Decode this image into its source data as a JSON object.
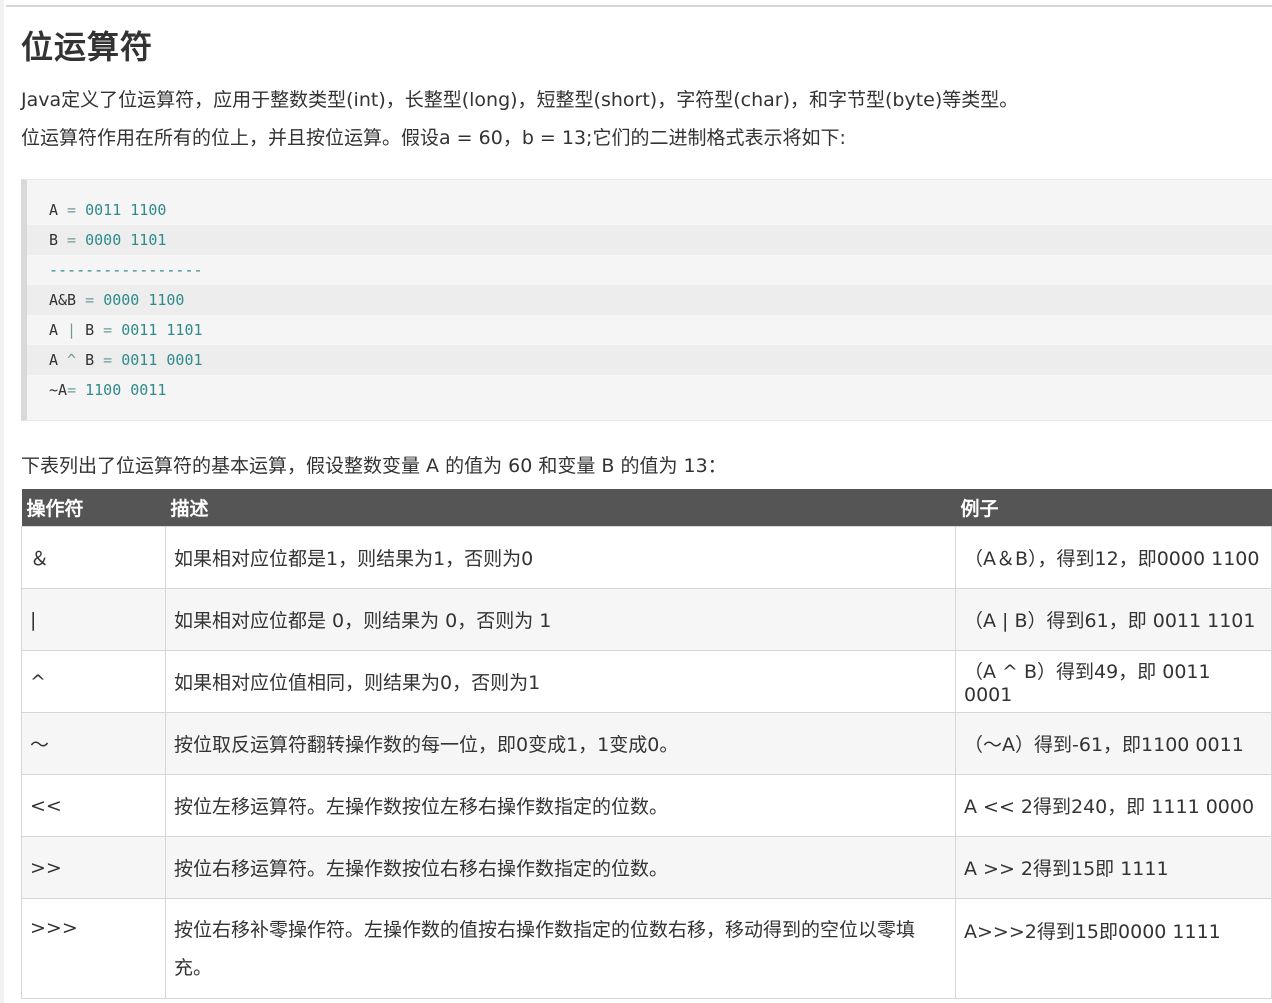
{
  "heading": "位运算符",
  "intro": {
    "line1": "Java定义了位运算符，应用于整数类型(int)，长整型(long)，短整型(short)，字符型(char)，和字节型(byte)等类型。",
    "line2": "位运算符作用在所有的位上，并且按位运算。假设a = 60，b = 13;它们的二进制格式表示将如下:"
  },
  "code": [
    {
      "lhs": "A",
      "op": " = ",
      "value": "0011 1100"
    },
    {
      "lhs": "B",
      "op": " = ",
      "value": "0000 1101"
    },
    {
      "dash": "-----------------"
    },
    {
      "lhs": "A&B",
      "op": " = ",
      "value": "0000 1100"
    },
    {
      "lhs": "A",
      "op": " | ",
      "lhs2": "B",
      "op2": " = ",
      "value": "0011 1101"
    },
    {
      "lhs": "A",
      "op": " ^ ",
      "lhs2": "B",
      "op2": " = ",
      "value": "0011 0001"
    },
    {
      "lhs": "~A",
      "op": "= ",
      "value": "1100 0011"
    }
  ],
  "table_intro": "下表列出了位运算符的基本运算，假设整数变量 A 的值为 60 和变量 B 的值为 13：",
  "table": {
    "headers": [
      "操作符",
      "描述",
      "例子"
    ],
    "rows": [
      [
        "＆",
        "如果相对应位都是1，则结果为1，否则为0",
        "（A＆B），得到12，即0000 1100"
      ],
      [
        "|",
        "如果相对应位都是 0，则结果为 0，否则为 1",
        "（A | B）得到61，即 0011 1101"
      ],
      [
        "^",
        "如果相对应位值相同，则结果为0，否则为1",
        "（A ^ B）得到49，即 0011 0001"
      ],
      [
        "〜",
        "按位取反运算符翻转操作数的每一位，即0变成1，1变成0。",
        "（〜A）得到-61，即1100 0011"
      ],
      [
        "<<",
        "按位左移运算符。左操作数按位左移右操作数指定的位数。",
        "A << 2得到240，即 1111 0000"
      ],
      [
        ">>",
        "按位右移运算符。左操作数按位右移右操作数指定的位数。",
        "A >> 2得到15即 1111"
      ],
      [
        ">>>",
        "按位右移补零操作符。左操作数的值按右操作数指定的位数右移，移动得到的空位以零填充。",
        "A>>>2得到15即0000 1111"
      ]
    ]
  }
}
